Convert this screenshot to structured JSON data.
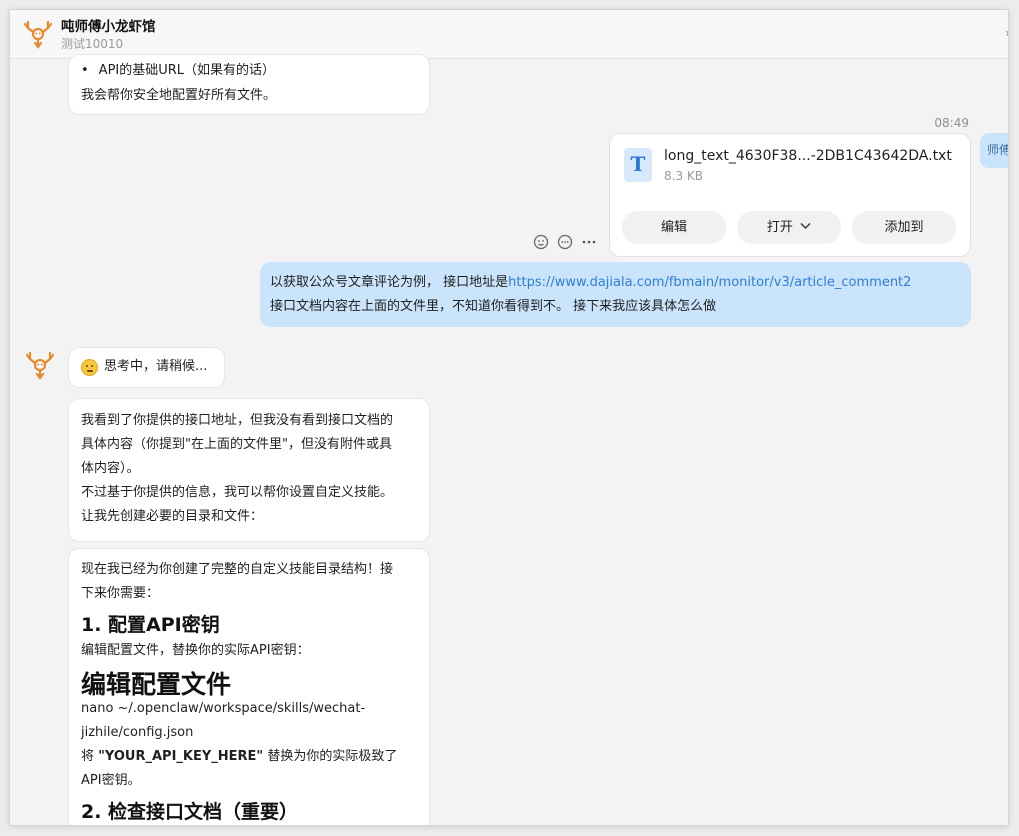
{
  "header": {
    "title": "吨师傅小龙虾馆",
    "subtitle": "测试10010",
    "arrow": "›"
  },
  "messages": {
    "m1": {
      "bullet": "•",
      "bullet_text": "API的基础URL（如果有的话）",
      "line2": "我会帮你安全地配置好所有文件。"
    },
    "time": "08:49",
    "file": {
      "icon_letter": "T",
      "name": "long_text_4630F38...-2DB1C43642DA.txt",
      "size": "8.3 KB",
      "buttons": {
        "edit": "编辑",
        "open": "打开",
        "add_to": "添加到"
      }
    },
    "peek_text": "师傅",
    "user": {
      "line1_prefix": "以获取公众号文章评论为例， 接口地址是",
      "line1_link": "https://www.dajiala.com/fbmain/monitor/v3/article_comment2",
      "line2": "接口文档内容在上面的文件里，不知道你看得到不。 接下来我应该具体怎么做"
    },
    "thinking": "思考中，请稍候...",
    "m3": {
      "l1": "我看到了你提供的接口地址，但我没有看到接口文档的",
      "l2": "具体内容（你提到\"在上面的文件里\"，但没有附件或具",
      "l3": "体内容）。",
      "l4": "不过基于你提供的信息，我可以帮你设置自定义技能。",
      "l5": "让我先创建必要的目录和文件："
    },
    "m4": {
      "l1": "现在我已经为你创建了完整的自定义技能目录结构！接",
      "l2": "下来你需要：",
      "h_step1": "1. 配置API密钥",
      "l3": "编辑配置文件，替换你的实际API密钥：",
      "h_big": "编辑配置文件",
      "code1": "nano ~/.openclaw/workspace/skills/wechat-",
      "code2": "jizhile/config.json",
      "l4_prefix": "将 ",
      "l4_bold": "\"YOUR_API_KEY_HERE\"",
      "l4_suffix": " 替换为你的实际极致了",
      "l5": "API密钥。",
      "h_step2": "2. 检查接口文档（重要）"
    }
  },
  "colors": {
    "user_bubble": "#c9e4fb",
    "link": "#2f7ed8",
    "avatar": "#e8892b"
  }
}
